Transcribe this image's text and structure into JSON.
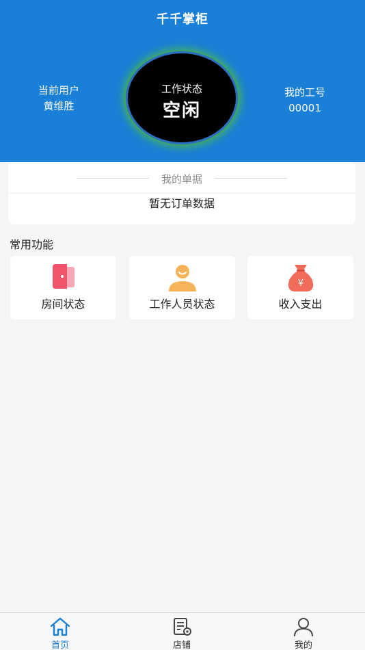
{
  "header": {
    "title": "千千掌柜",
    "current_user_label": "当前用户",
    "current_user_name": "黄维胜",
    "job_id_label": "我的工号",
    "job_id": "00001",
    "work_status_label": "工作状态",
    "work_status_value": "空闲"
  },
  "orders": {
    "title": "我的单据",
    "empty_text": "暂无订单数据"
  },
  "functions": {
    "title": "常用功能",
    "items": [
      {
        "label": "房间状态",
        "icon": "door-icon"
      },
      {
        "label": "工作人员状态",
        "icon": "staff-icon"
      },
      {
        "label": "收入支出",
        "icon": "money-bag-icon"
      }
    ]
  },
  "tabbar": {
    "items": [
      {
        "label": "首页",
        "icon": "home-icon",
        "active": true
      },
      {
        "label": "店铺",
        "icon": "shop-settings-icon",
        "active": false
      },
      {
        "label": "我的",
        "icon": "user-icon",
        "active": false
      }
    ]
  },
  "colors": {
    "primary": "#1a7fd6",
    "background": "#f5f5f6",
    "status_glow": "#3fb060",
    "door_red": "#f0546a",
    "staff_orange": "#f6b45a",
    "money_red": "#f26a5a"
  }
}
